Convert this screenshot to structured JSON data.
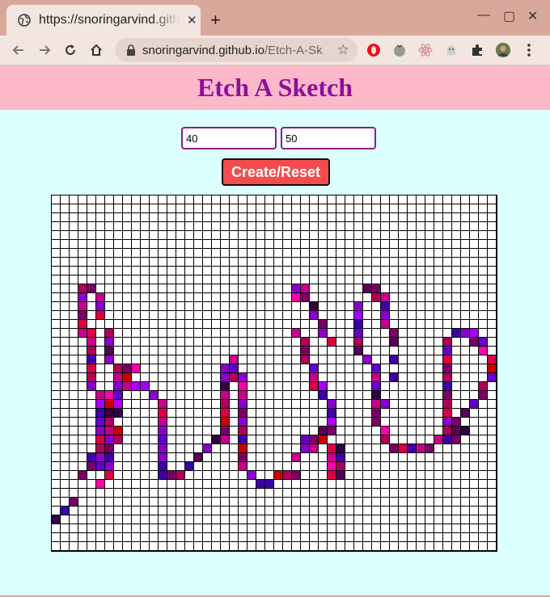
{
  "browser": {
    "tab_title": "https://snoringarvind.github.io/Etch-A-Sketch/",
    "url_host": "snoringarvind.github.io",
    "url_path": "/Etch-A-Sk…",
    "icons": [
      "globe-icon",
      "close-icon",
      "plus-icon",
      "minimize-icon",
      "maximize-icon",
      "window-close-icon",
      "back-icon",
      "forward-icon",
      "reload-icon",
      "home-icon",
      "lock-icon",
      "star-icon",
      "opera-icon",
      "tomato-icon",
      "react-icon",
      "ghost-icon",
      "puzzle-icon",
      "profile-avatar",
      "menu-icon"
    ]
  },
  "page": {
    "title": "Etch A Sketch",
    "rows_value": "40",
    "cols_value": "50",
    "create_label": "Create/Reset",
    "colors": {
      "header_bg": "#fdb8c9",
      "title": "#8e0f9a",
      "page_bg": "#dcffff",
      "button_bg": "#f44c4c",
      "input_border": "#8c1a8a"
    }
  },
  "grid": {
    "rows": 40,
    "cols": 50,
    "palette": [
      "#b0005a",
      "#7a0066",
      "#8b00cc",
      "#c8008a",
      "#dd0044",
      "#5a0055",
      "#3d00aa",
      "#ff00aa",
      "#cc0000",
      "#6600cc",
      "#aa00ff",
      "#330044"
    ],
    "painted": [
      [
        10,
        3,
        0
      ],
      [
        10,
        4,
        1
      ],
      [
        11,
        3,
        2
      ],
      [
        11,
        5,
        3
      ],
      [
        12,
        3,
        3
      ],
      [
        12,
        5,
        2
      ],
      [
        13,
        3,
        1
      ],
      [
        13,
        5,
        4
      ],
      [
        14,
        3,
        4
      ],
      [
        15,
        3,
        3
      ],
      [
        15,
        4,
        4
      ],
      [
        15,
        6,
        0
      ],
      [
        16,
        4,
        3
      ],
      [
        16,
        6,
        2
      ],
      [
        17,
        4,
        0
      ],
      [
        17,
        6,
        5
      ],
      [
        18,
        4,
        6
      ],
      [
        18,
        6,
        2
      ],
      [
        19,
        4,
        4
      ],
      [
        19,
        7,
        0
      ],
      [
        19,
        8,
        1
      ],
      [
        19,
        9,
        7
      ],
      [
        20,
        4,
        0
      ],
      [
        20,
        7,
        3
      ],
      [
        20,
        8,
        8
      ],
      [
        21,
        4,
        2
      ],
      [
        21,
        7,
        2
      ],
      [
        21,
        8,
        3
      ],
      [
        21,
        9,
        10
      ],
      [
        21,
        10,
        10
      ],
      [
        22,
        5,
        3
      ],
      [
        22,
        6,
        7
      ],
      [
        22,
        7,
        9
      ],
      [
        23,
        5,
        10
      ],
      [
        23,
        6,
        8
      ],
      [
        23,
        7,
        10
      ],
      [
        24,
        5,
        6
      ],
      [
        24,
        6,
        11
      ],
      [
        24,
        7,
        11
      ],
      [
        25,
        5,
        9
      ],
      [
        25,
        6,
        0
      ],
      [
        26,
        5,
        2
      ],
      [
        26,
        6,
        3
      ],
      [
        26,
        7,
        8
      ],
      [
        27,
        5,
        4
      ],
      [
        27,
        6,
        2
      ],
      [
        27,
        7,
        0
      ],
      [
        28,
        5,
        0
      ],
      [
        28,
        6,
        1
      ],
      [
        29,
        4,
        6
      ],
      [
        29,
        5,
        2
      ],
      [
        29,
        6,
        6
      ],
      [
        30,
        4,
        1
      ],
      [
        30,
        5,
        9
      ],
      [
        30,
        6,
        2
      ],
      [
        31,
        3,
        1
      ],
      [
        31,
        6,
        4
      ],
      [
        32,
        5,
        7
      ],
      [
        34,
        2,
        1
      ],
      [
        35,
        1,
        6
      ],
      [
        36,
        0,
        11
      ],
      [
        22,
        11,
        2
      ],
      [
        23,
        12,
        3
      ],
      [
        24,
        12,
        4
      ],
      [
        25,
        12,
        3
      ],
      [
        26,
        12,
        2
      ],
      [
        27,
        12,
        9
      ],
      [
        28,
        12,
        2
      ],
      [
        29,
        12,
        2
      ],
      [
        30,
        12,
        6
      ],
      [
        31,
        12,
        6
      ],
      [
        31,
        13,
        1
      ],
      [
        31,
        14,
        0
      ],
      [
        30,
        15,
        6
      ],
      [
        29,
        16,
        5
      ],
      [
        28,
        17,
        2
      ],
      [
        27,
        18,
        11
      ],
      [
        27,
        19,
        3
      ],
      [
        26,
        19,
        1
      ],
      [
        25,
        19,
        8
      ],
      [
        24,
        19,
        4
      ],
      [
        23,
        19,
        0
      ],
      [
        22,
        19,
        3
      ],
      [
        21,
        19,
        11
      ],
      [
        20,
        19,
        2
      ],
      [
        19,
        19,
        2
      ],
      [
        20,
        20,
        0
      ],
      [
        19,
        20,
        9
      ],
      [
        18,
        20,
        3
      ],
      [
        20,
        21,
        2
      ],
      [
        21,
        21,
        7
      ],
      [
        22,
        21,
        3
      ],
      [
        23,
        21,
        2
      ],
      [
        24,
        21,
        1
      ],
      [
        25,
        21,
        2
      ],
      [
        26,
        21,
        0
      ],
      [
        27,
        21,
        6
      ],
      [
        28,
        21,
        8
      ],
      [
        29,
        21,
        1
      ],
      [
        30,
        21,
        3
      ],
      [
        31,
        22,
        2
      ],
      [
        32,
        23,
        6
      ],
      [
        32,
        24,
        6
      ],
      [
        31,
        25,
        8
      ],
      [
        31,
        26,
        0
      ],
      [
        31,
        27,
        1
      ],
      [
        10,
        27,
        2
      ],
      [
        10,
        28,
        3
      ],
      [
        11,
        27,
        7
      ],
      [
        11,
        28,
        1
      ],
      [
        12,
        29,
        11
      ],
      [
        13,
        29,
        2
      ],
      [
        14,
        30,
        1
      ],
      [
        15,
        27,
        3
      ],
      [
        15,
        30,
        2
      ],
      [
        16,
        28,
        0
      ],
      [
        16,
        31,
        4
      ],
      [
        17,
        28,
        1
      ],
      [
        18,
        28,
        0
      ],
      [
        19,
        29,
        9
      ],
      [
        20,
        29,
        3
      ],
      [
        21,
        29,
        4
      ],
      [
        21,
        30,
        10
      ],
      [
        22,
        30,
        6
      ],
      [
        23,
        31,
        2
      ],
      [
        24,
        31,
        6
      ],
      [
        25,
        31,
        10
      ],
      [
        26,
        30,
        5
      ],
      [
        26,
        31,
        1
      ],
      [
        27,
        28,
        9
      ],
      [
        27,
        29,
        1
      ],
      [
        27,
        30,
        8
      ],
      [
        28,
        28,
        2
      ],
      [
        28,
        29,
        3
      ],
      [
        28,
        31,
        4
      ],
      [
        28,
        32,
        11
      ],
      [
        29,
        27,
        3
      ],
      [
        29,
        31,
        3
      ],
      [
        29,
        32,
        6
      ],
      [
        30,
        31,
        7
      ],
      [
        30,
        32,
        0
      ],
      [
        31,
        31,
        4
      ],
      [
        31,
        32,
        5
      ],
      [
        10,
        35,
        5
      ],
      [
        10,
        36,
        1
      ],
      [
        11,
        36,
        0
      ],
      [
        11,
        37,
        3
      ],
      [
        12,
        34,
        2
      ],
      [
        12,
        37,
        6
      ],
      [
        13,
        34,
        10
      ],
      [
        13,
        37,
        2
      ],
      [
        14,
        34,
        6
      ],
      [
        14,
        37,
        3
      ],
      [
        15,
        34,
        9
      ],
      [
        15,
        38,
        1
      ],
      [
        16,
        34,
        0
      ],
      [
        16,
        38,
        5
      ],
      [
        17,
        34,
        5
      ],
      [
        18,
        35,
        2
      ],
      [
        18,
        38,
        6
      ],
      [
        19,
        36,
        9
      ],
      [
        20,
        36,
        3
      ],
      [
        20,
        38,
        6
      ],
      [
        21,
        36,
        9
      ],
      [
        22,
        36,
        11
      ],
      [
        23,
        36,
        3
      ],
      [
        23,
        37,
        2
      ],
      [
        24,
        36,
        1
      ],
      [
        25,
        36,
        1
      ],
      [
        26,
        37,
        7
      ],
      [
        27,
        37,
        0
      ],
      [
        28,
        38,
        1
      ],
      [
        28,
        39,
        4
      ],
      [
        28,
        40,
        6
      ],
      [
        28,
        41,
        3
      ],
      [
        28,
        42,
        1
      ],
      [
        27,
        43,
        3
      ],
      [
        27,
        44,
        6
      ],
      [
        26,
        44,
        0
      ],
      [
        25,
        44,
        2
      ],
      [
        24,
        44,
        4
      ],
      [
        23,
        44,
        0
      ],
      [
        22,
        44,
        1
      ],
      [
        21,
        44,
        6
      ],
      [
        20,
        44,
        0
      ],
      [
        19,
        44,
        1
      ],
      [
        18,
        44,
        4
      ],
      [
        17,
        44,
        9
      ],
      [
        16,
        44,
        0
      ],
      [
        15,
        45,
        6
      ],
      [
        15,
        46,
        2
      ],
      [
        15,
        47,
        10
      ],
      [
        16,
        47,
        1
      ],
      [
        16,
        48,
        9
      ],
      [
        17,
        48,
        7
      ],
      [
        18,
        49,
        4
      ],
      [
        19,
        49,
        8
      ],
      [
        20,
        49,
        9
      ],
      [
        21,
        48,
        0
      ],
      [
        22,
        48,
        1
      ],
      [
        23,
        47,
        9
      ],
      [
        24,
        46,
        5
      ],
      [
        25,
        45,
        1
      ],
      [
        26,
        45,
        5
      ],
      [
        27,
        45,
        1
      ],
      [
        26,
        46,
        11
      ]
    ]
  }
}
